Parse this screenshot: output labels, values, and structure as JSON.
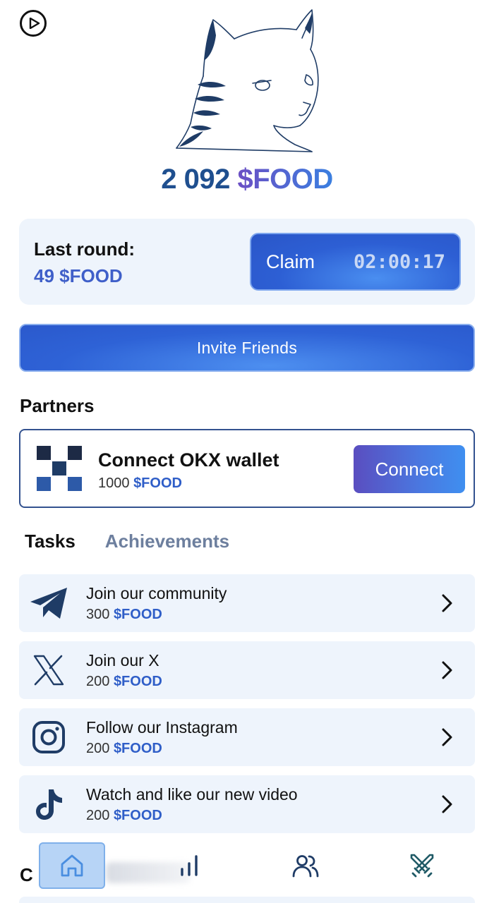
{
  "header": {
    "play_icon": "play-circle-icon",
    "mascot": "cat-mascot-illustration"
  },
  "balance": {
    "amount": "2 092",
    "currency": "$FOOD"
  },
  "last_round": {
    "label": "Last round:",
    "value": "49 $FOOD",
    "claim_label": "Claim",
    "timer": "02:00:17"
  },
  "invite": {
    "label": "Invite Friends"
  },
  "partners": {
    "title": "Partners",
    "items": [
      {
        "icon": "okx-logo-icon",
        "title": "Connect OKX wallet",
        "amount": "1000",
        "currency": "$FOOD",
        "button_label": "Connect"
      }
    ]
  },
  "tabs": [
    {
      "label": "Tasks",
      "active": true
    },
    {
      "label": "Achievements",
      "active": false
    }
  ],
  "tasks": [
    {
      "icon": "telegram-icon",
      "title": "Join our community",
      "amount": "300",
      "currency": "$FOOD"
    },
    {
      "icon": "x-icon",
      "title": "Join our X",
      "amount": "200",
      "currency": "$FOOD"
    },
    {
      "icon": "instagram-icon",
      "title": "Follow our Instagram",
      "amount": "200",
      "currency": "$FOOD"
    },
    {
      "icon": "tiktok-icon",
      "title": "Watch and like our new video",
      "amount": "200",
      "currency": "$FOOD"
    }
  ],
  "bottom_partial": {
    "letter": "C"
  },
  "nav": [
    {
      "icon": "home-icon",
      "active": true
    },
    {
      "icon": "leaderboard-icon",
      "active": false
    },
    {
      "icon": "friends-icon",
      "active": false
    },
    {
      "icon": "battle-icon",
      "active": false
    }
  ],
  "colors": {
    "accent_blue": "#2e62d6",
    "currency_blue": "#2f5ec8",
    "card_bg": "#eef4fc",
    "balance_number": "#1f4f8f"
  }
}
